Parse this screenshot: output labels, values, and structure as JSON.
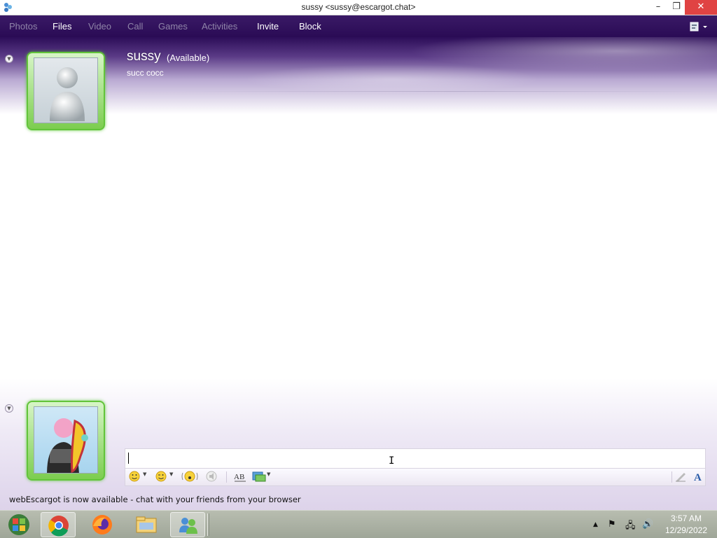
{
  "window": {
    "title": "sussy <sussy@escargot.chat>",
    "minimize": "–",
    "maximize": "❐",
    "close": "✕"
  },
  "menu": {
    "items": [
      {
        "label": "Photos",
        "enabled": false
      },
      {
        "label": "Files",
        "enabled": true
      },
      {
        "label": "Video",
        "enabled": false
      },
      {
        "label": "Call",
        "enabled": false
      },
      {
        "label": "Games",
        "enabled": false
      },
      {
        "label": "Activities",
        "enabled": false
      },
      {
        "label": "Invite",
        "enabled": true
      },
      {
        "label": "Block",
        "enabled": true
      }
    ]
  },
  "contact": {
    "name": "sussy",
    "status": "(Available)",
    "personal_message": "succ cocc",
    "status_color": "#62c43a"
  },
  "compose": {
    "text": ""
  },
  "toolbar": {
    "icons": [
      "emoticon-icon",
      "wink-icon",
      "nudge-icon",
      "voice-clip-icon",
      "font-icon",
      "background-icon",
      "handwriting-icon",
      "text-format-icon"
    ]
  },
  "notice": {
    "text": "webEscargot is now available - chat with your friends from your browser"
  },
  "taskbar": {
    "apps": [
      "start-orb-icon",
      "chrome-icon",
      "firefox-icon",
      "file-explorer-icon",
      "messenger-icon"
    ],
    "clock_time": "3:57 AM",
    "clock_date": "12/29/2022"
  },
  "colors": {
    "menu_bg": "#2a0b55",
    "close_btn": "#e04343",
    "accent_green": "#62c43a"
  }
}
